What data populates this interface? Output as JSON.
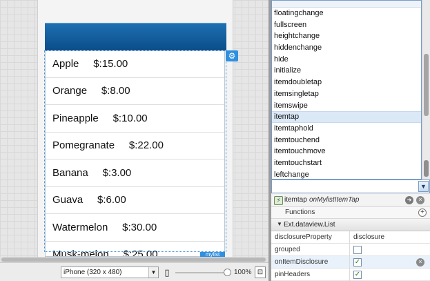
{
  "canvas": {
    "list_items": [
      {
        "name": "Apple",
        "price": "$:15.00"
      },
      {
        "name": "Orange",
        "price": "$:8.00"
      },
      {
        "name": "Pineapple",
        "price": "$:10.00"
      },
      {
        "name": "Pomegranate",
        "price": "$:22.00"
      },
      {
        "name": "Banana",
        "price": "$:3.00"
      },
      {
        "name": "Guava",
        "price": "$:6.00"
      },
      {
        "name": "Watermelon",
        "price": "$:30.00"
      },
      {
        "name": "Musk-melon",
        "price": "$:25.00"
      }
    ],
    "component_tag": "mylist",
    "gear_icon": "gear-icon"
  },
  "bottom_bar": {
    "device_selected": "iPhone (320 x 480)",
    "zoom_level": "100%",
    "zoom_fraction": 1.0
  },
  "events": {
    "items": [
      "floatingchange",
      "fullscreen",
      "heightchange",
      "hiddenchange",
      "hide",
      "initialize",
      "itemdoubletap",
      "itemsingletap",
      "itemswipe",
      "itemtap",
      "itemtaphold",
      "itemtouchend",
      "itemtouchmove",
      "itemtouchstart",
      "leftchange"
    ],
    "selected": "itemtap"
  },
  "handler": {
    "event": "itemtap",
    "function_name": "onMylistItemTap"
  },
  "functions_label": "Functions",
  "config_group": "Ext.dataview.List",
  "properties": [
    {
      "name": "disclosureProperty",
      "value": "disclosure",
      "type": "text"
    },
    {
      "name": "grouped",
      "checked": false,
      "type": "checkbox"
    },
    {
      "name": "onItemDisclosure",
      "checked": true,
      "type": "checkbox",
      "clearable": true
    },
    {
      "name": "pinHeaders",
      "checked": true,
      "type": "checkbox"
    }
  ]
}
